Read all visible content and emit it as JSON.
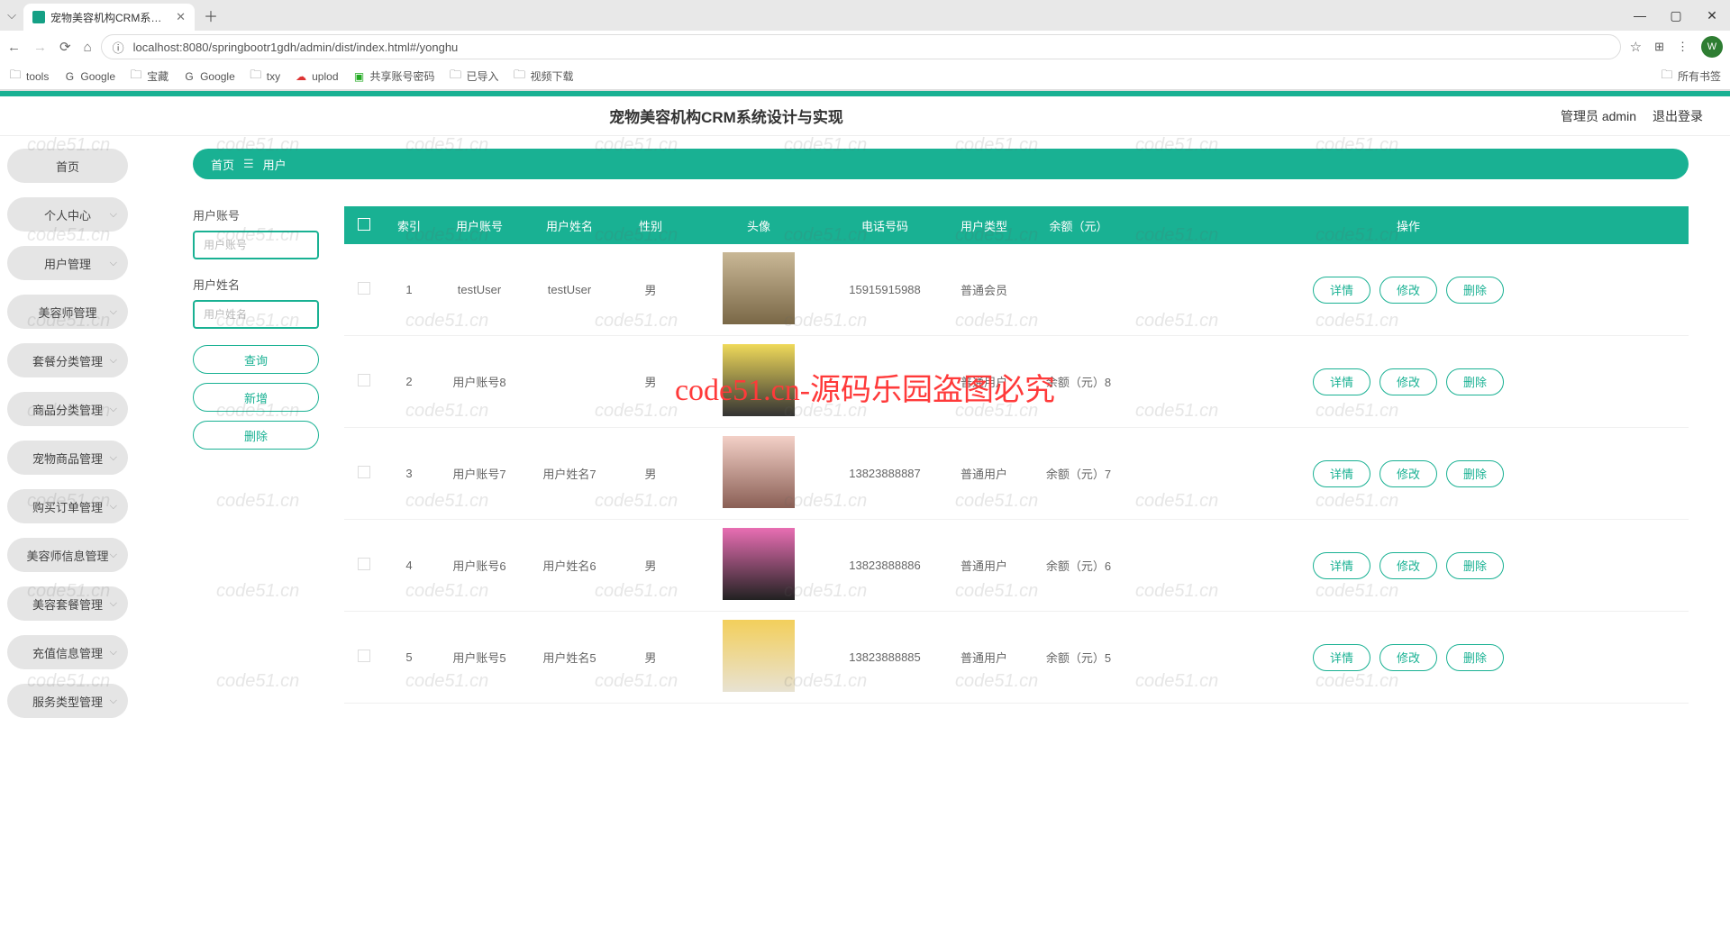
{
  "browser": {
    "tab_title": "宠物美容机构CRM系统设计与",
    "url": "localhost:8080/springbootr1gdh/admin/dist/index.html#/yonghu",
    "new_tab": "＋",
    "profile_letter": "W",
    "bookmarks": [
      "tools",
      "Google",
      "宝藏",
      "Google",
      "txy",
      "uplod",
      "共享账号密码",
      "已导入",
      "视频下载"
    ],
    "all_bookmarks": "所有书签"
  },
  "header": {
    "title": "宠物美容机构CRM系统设计与实现",
    "admin_label": "管理员 admin",
    "logout": "退出登录"
  },
  "sidebar": {
    "items": [
      {
        "label": "首页",
        "has_children": false
      },
      {
        "label": "个人中心",
        "has_children": true
      },
      {
        "label": "用户管理",
        "has_children": true
      },
      {
        "label": "美容师管理",
        "has_children": true
      },
      {
        "label": "套餐分类管理",
        "has_children": true
      },
      {
        "label": "商品分类管理",
        "has_children": true
      },
      {
        "label": "宠物商品管理",
        "has_children": true
      },
      {
        "label": "购买订单管理",
        "has_children": true
      },
      {
        "label": "美容师信息管理",
        "has_children": true
      },
      {
        "label": "美容套餐管理",
        "has_children": true
      },
      {
        "label": "充值信息管理",
        "has_children": true
      },
      {
        "label": "服务类型管理",
        "has_children": true
      }
    ]
  },
  "breadcrumb": {
    "home": "首页",
    "sep": "☰",
    "current": "用户"
  },
  "search": {
    "account_label": "用户账号",
    "account_placeholder": "用户账号",
    "name_label": "用户姓名",
    "name_placeholder": "用户姓名",
    "query_btn": "查询",
    "add_btn": "新增",
    "delete_btn": "删除"
  },
  "table": {
    "headers": {
      "index": "索引",
      "account": "用户账号",
      "name": "用户姓名",
      "gender": "性别",
      "avatar": "头像",
      "phone": "电话号码",
      "type": "用户类型",
      "balance": "余额（元）",
      "actions": "操作"
    },
    "actions": {
      "detail": "详情",
      "edit": "修改",
      "delete": "删除"
    },
    "rows": [
      {
        "index": "1",
        "account": "testUser",
        "name": "testUser",
        "gender": "男",
        "phone": "15915915988",
        "type": "普通会员",
        "balance": ""
      },
      {
        "index": "2",
        "account": "用户账号8",
        "name": "",
        "gender": "男",
        "phone": "",
        "type": "普通用户",
        "balance": "余额（元）8"
      },
      {
        "index": "3",
        "account": "用户账号7",
        "name": "用户姓名7",
        "gender": "男",
        "phone": "13823888887",
        "type": "普通用户",
        "balance": "余额（元）7"
      },
      {
        "index": "4",
        "account": "用户账号6",
        "name": "用户姓名6",
        "gender": "男",
        "phone": "13823888886",
        "type": "普通用户",
        "balance": "余额（元）6"
      },
      {
        "index": "5",
        "account": "用户账号5",
        "name": "用户姓名5",
        "gender": "男",
        "phone": "13823888885",
        "type": "普通用户",
        "balance": "余额（元）5"
      }
    ]
  },
  "watermark": {
    "repeat": "code51.cn",
    "center": "code51.cn-源码乐园盗图必究"
  }
}
